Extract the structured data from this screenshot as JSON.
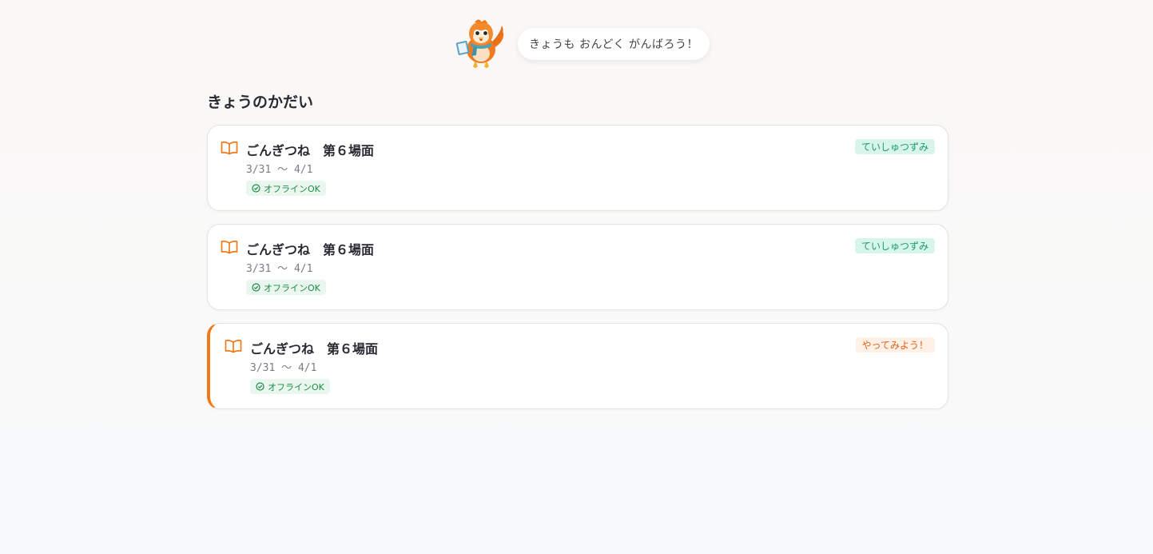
{
  "mascot": {
    "icon": "bird-mascot-icon",
    "message": "きょうも おんどく がんばろう！"
  },
  "section": {
    "title": "きょうのかだい"
  },
  "colors": {
    "accent": "#f07a1a",
    "done_bg": "#d7f5ea",
    "done_text": "#1f9a74",
    "todo_bg": "#fff1e6",
    "todo_text": "#e0621a",
    "offline_bg": "#eaf7ee",
    "offline_text": "#1f8a4a"
  },
  "tasks": [
    {
      "icon": "book-icon",
      "title": "ごんぎつね　第６場面",
      "dates": "3/31 〜 4/1",
      "offline": "オフラインOK",
      "status": "ていしゅつずみ"
    },
    {
      "icon": "book-icon",
      "title": "ごんぎつね　第６場面",
      "dates": "3/31 〜 4/1",
      "offline": "オフラインOK",
      "status": "ていしゅつずみ"
    },
    {
      "icon": "book-icon",
      "title": "ごんぎつね　第６場面",
      "dates": "3/31 〜 4/1",
      "offline": "オフラインOK",
      "status": "やってみよう！"
    }
  ]
}
